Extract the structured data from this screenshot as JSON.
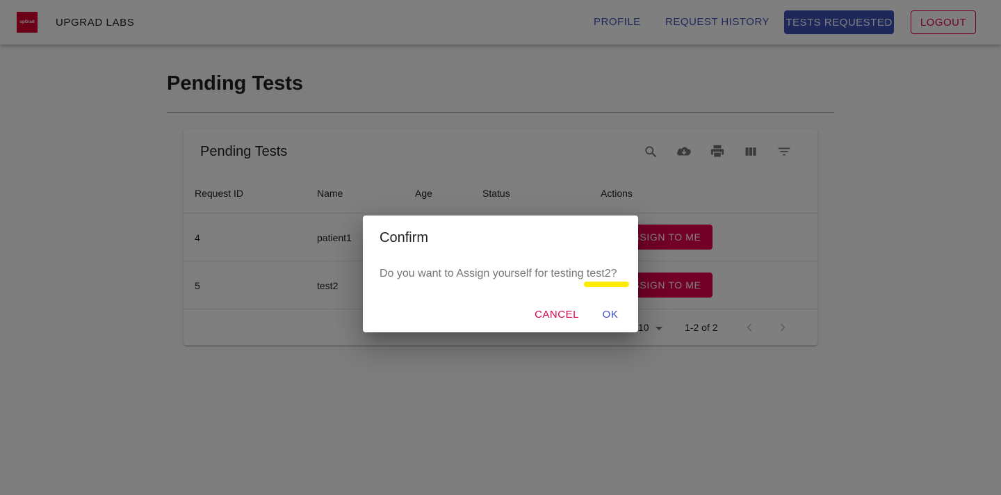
{
  "app": {
    "logo_text": "upGrad",
    "brand": "UPGRAD LABS",
    "nav": {
      "profile": "PROFILE",
      "request_history": "REQUEST HISTORY",
      "tests_requested": "TESTS REQUESTED",
      "logout": "LOGOUT"
    }
  },
  "page": {
    "title": "Pending Tests"
  },
  "table": {
    "title": "Pending Tests",
    "toolbar_icons": [
      "search-icon",
      "download-icon",
      "print-icon",
      "view-columns-icon",
      "filter-icon"
    ],
    "columns": [
      "Request ID",
      "Name",
      "Age",
      "Status",
      "Actions"
    ],
    "rows": [
      {
        "request_id": "4",
        "name": "patient1",
        "action": "ASSIGN TO ME"
      },
      {
        "request_id": "5",
        "name": "test2",
        "action": "ASSIGN TO ME"
      }
    ],
    "pagination": {
      "rows_per_page_value": "10",
      "range": "1-2 of 2"
    }
  },
  "dialog": {
    "title": "Confirm",
    "message": "Do you want to Assign yourself for testing test2?",
    "cancel": "CANCEL",
    "ok": "OK"
  },
  "colors": {
    "primary": "#3f51b5",
    "secondary": "#e5004f",
    "highlight": "#ffeb00"
  }
}
